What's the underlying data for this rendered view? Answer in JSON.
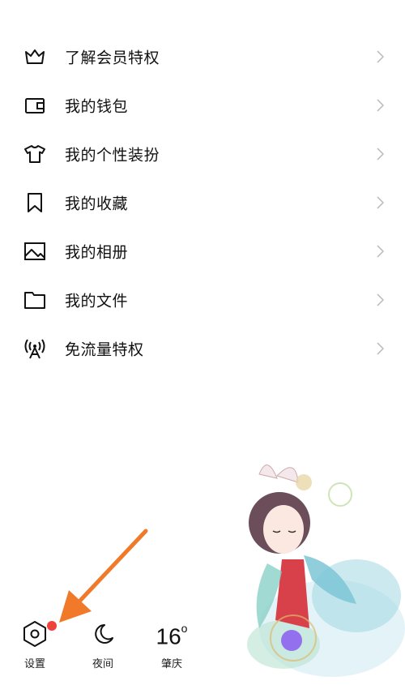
{
  "menu": {
    "items": [
      {
        "label": "了解会员特权",
        "icon": "crown-icon"
      },
      {
        "label": "我的钱包",
        "icon": "wallet-icon"
      },
      {
        "label": "我的个性装扮",
        "icon": "tshirt-icon"
      },
      {
        "label": "我的收藏",
        "icon": "bookmark-icon"
      },
      {
        "label": "我的相册",
        "icon": "photo-album-icon"
      },
      {
        "label": "我的文件",
        "icon": "folder-icon"
      },
      {
        "label": "免流量特权",
        "icon": "signal-tower-icon"
      }
    ]
  },
  "bottom_bar": {
    "settings_label": "设置",
    "night_label": "夜间",
    "weather_temp": "16",
    "weather_unit": "o",
    "weather_city": "肇庆"
  },
  "colors": {
    "text": "#111111",
    "chevron": "#b9b9b9",
    "badge": "#f0413b",
    "annotation_arrow": "#f07a2a"
  }
}
